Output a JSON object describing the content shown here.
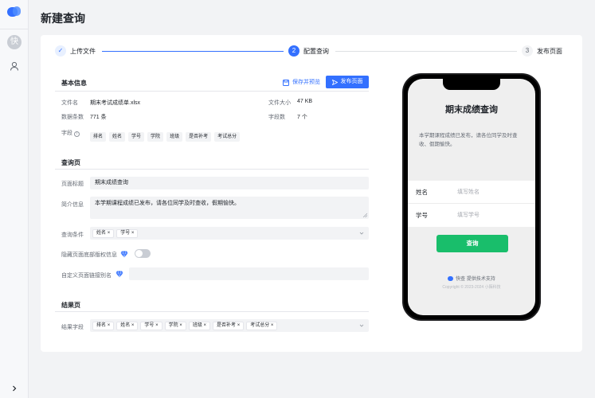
{
  "sidebar": {
    "avatar_text": "快"
  },
  "page_title": "新建查询",
  "steps": [
    {
      "num": "✓",
      "label": "上传文件"
    },
    {
      "num": "2",
      "label": "配置查询"
    },
    {
      "num": "3",
      "label": "发布页面"
    }
  ],
  "basic": {
    "title": "基本信息",
    "save_label": "保存并预览",
    "publish_label": "发布页面",
    "file_name_label": "文件名",
    "file_name": "期末考试成绩单.xlsx",
    "file_size_label": "文件大小",
    "file_size": "47 KB",
    "rows_label": "数据条数",
    "rows": "771 条",
    "fields_count_label": "字段数",
    "fields_count": "7 个",
    "fields_label": "字段",
    "fields": [
      "排名",
      "姓名",
      "学号",
      "学院",
      "班级",
      "是否补考",
      "考试总分"
    ]
  },
  "query": {
    "title": "查询页",
    "page_title_label": "页面标题",
    "page_title_value": "期末成绩查询",
    "intro_label": "简介信息",
    "intro_value": "本学期课程成绩已发布，请各位同学及时查收，假期愉快。",
    "conditions_label": "查询条件",
    "conditions": [
      "姓名",
      "学号"
    ],
    "hide_footer_label": "隐藏页面底部版权信息",
    "alias_label": "自定义页面链接别名"
  },
  "result": {
    "title": "结果页",
    "fields_label": "结果字段",
    "fields": [
      "排名",
      "姓名",
      "学号",
      "学院",
      "班级",
      "是否补考",
      "考试总分"
    ]
  },
  "phone": {
    "title": "期末成绩查询",
    "desc": "本学期课程成绩已发布，请各位同学及时查收、假期愉快。",
    "name_label": "姓名",
    "name_placeholder": "填写姓名",
    "id_label": "学号",
    "id_placeholder": "填写学号",
    "button": "查询",
    "footer": "快查 提供技术支持",
    "copyright": "Copyright © 2023-2024 小陌科技"
  },
  "colors": {
    "accent": "#3370ff",
    "query_button": "#19be6b"
  }
}
